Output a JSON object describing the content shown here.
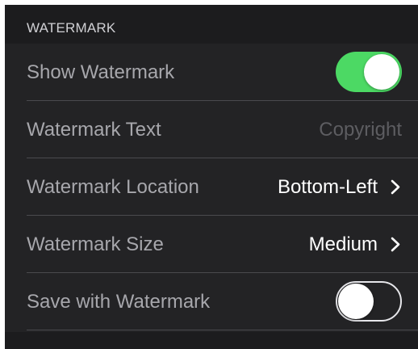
{
  "section": {
    "header": "WATERMARK"
  },
  "rows": [
    {
      "label": "Show Watermark",
      "toggle_on": true
    },
    {
      "label": "Watermark Text",
      "placeholder": "Copyright"
    },
    {
      "label": "Watermark Location",
      "value": "Bottom-Left"
    },
    {
      "label": "Watermark Size",
      "value": "Medium"
    },
    {
      "label": "Save with Watermark",
      "toggle_on": false
    }
  ],
  "colors": {
    "background": "#1c1c1e",
    "cell_background": "#232325",
    "label_text": "#a7a7ac",
    "value_text": "#ffffff",
    "placeholder_text": "#5d5d61",
    "toggle_on": "#4cd964",
    "separator": "#4a4a4e"
  },
  "icons": {
    "chevron": "chevron-right-icon"
  }
}
